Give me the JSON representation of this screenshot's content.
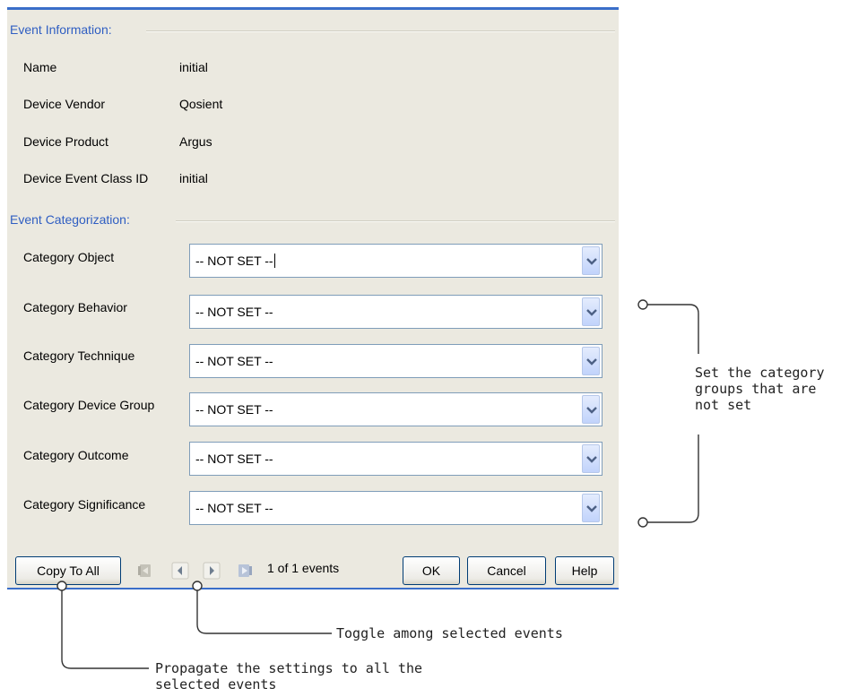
{
  "event_information": {
    "heading": "Event Information:",
    "fields": [
      {
        "label": "Name",
        "value": "initial"
      },
      {
        "label": "Device Vendor",
        "value": "Qosient"
      },
      {
        "label": "Device Product",
        "value": "Argus"
      },
      {
        "label": "Device Event Class ID",
        "value": "initial"
      }
    ]
  },
  "event_categorization": {
    "heading": "Event Categorization:",
    "fields": [
      {
        "label": "Category Object",
        "value": "-- NOT SET --"
      },
      {
        "label": "Category Behavior",
        "value": "-- NOT SET --"
      },
      {
        "label": "Category Technique",
        "value": "-- NOT SET --"
      },
      {
        "label": "Category Device Group",
        "value": "-- NOT SET --"
      },
      {
        "label": "Category Outcome",
        "value": "-- NOT SET --"
      },
      {
        "label": "Category Significance",
        "value": "-- NOT SET --"
      }
    ]
  },
  "footer": {
    "copy_to_all": "Copy To All",
    "event_counter": "1 of 1 events",
    "ok": "OK",
    "cancel": "Cancel",
    "help": "Help"
  },
  "icons": [
    "first-event-icon",
    "previous-event-icon",
    "next-event-icon",
    "last-event-icon",
    "chevron-down-icon"
  ],
  "annotations": {
    "set_categories": [
      "Set the category",
      "groups that are",
      "not set"
    ],
    "toggle": "Toggle among selected events",
    "propagate": [
      "Propagate the settings to all the",
      "selected events"
    ]
  },
  "colors": {
    "accent": "#3a6ec9",
    "heading": "#2f5ec2",
    "dialog_bg": "#ebe9e0"
  }
}
